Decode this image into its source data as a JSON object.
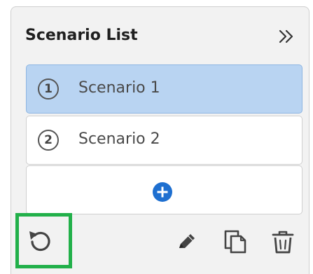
{
  "panel": {
    "title": "Scenario List",
    "collapse_icon": "chevron-double-right-icon"
  },
  "scenarios": [
    {
      "number": "1",
      "label": "Scenario 1",
      "selected": true
    },
    {
      "number": "2",
      "label": "Scenario 2",
      "selected": false
    }
  ],
  "add_scenario": {
    "icon": "plus-circle-icon"
  },
  "toolbar": {
    "icons": [
      "reset-icon",
      "pencil-icon",
      "copy-icon",
      "trash-icon"
    ]
  },
  "colors": {
    "selected_bg": "#b9d4f2",
    "accent_blue": "#1e6fd0",
    "highlight_green": "#22b04a"
  }
}
